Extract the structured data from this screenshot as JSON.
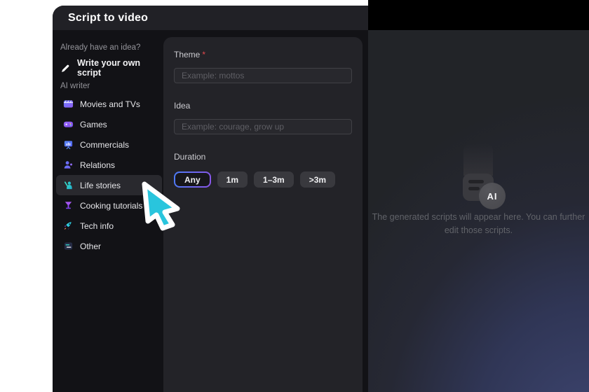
{
  "window": {
    "title": "Script to video"
  },
  "sidebar": {
    "section1_label": "Already have an idea?",
    "write_own": {
      "label": "Write your own script",
      "icon": "pencil-icon"
    },
    "section2_label": "AI writer",
    "items": [
      {
        "label": "Movies and TVs",
        "icon": "clapperboard-icon",
        "selected": false
      },
      {
        "label": "Games",
        "icon": "gamepad-icon",
        "selected": false
      },
      {
        "label": "Commercials",
        "icon": "presentation-icon",
        "selected": false
      },
      {
        "label": "Relations",
        "icon": "person-icon",
        "selected": false
      },
      {
        "label": "Life stories",
        "icon": "waving-person-icon",
        "selected": true
      },
      {
        "label": "Cooking tutorials",
        "icon": "cocktail-icon",
        "selected": false
      },
      {
        "label": "Tech info",
        "icon": "rocket-icon",
        "selected": false
      },
      {
        "label": "Other",
        "icon": "list-icon",
        "selected": false
      }
    ]
  },
  "form": {
    "theme": {
      "label": "Theme",
      "required_mark": "*",
      "placeholder": "Example: mottos",
      "value": ""
    },
    "idea": {
      "label": "Idea",
      "placeholder": "Example: courage, grow up",
      "value": ""
    },
    "duration": {
      "label": "Duration",
      "options": [
        {
          "label": "Any",
          "selected": true
        },
        {
          "label": "1m",
          "selected": false
        },
        {
          "label": "1–3m",
          "selected": false
        },
        {
          "label": ">3m",
          "selected": false
        }
      ]
    }
  },
  "preview": {
    "badge_label": "AI",
    "empty_line1": "The generated scripts will appear here. You can further",
    "empty_line2": "edit those scripts."
  },
  "colors": {
    "accent_blue": "#4b7bf5",
    "accent_purple": "#8a55e8",
    "required_mark": "#e5484d",
    "cursor": "#29c5dd",
    "panel_bg": "#232328",
    "window_bg": "#121216"
  }
}
